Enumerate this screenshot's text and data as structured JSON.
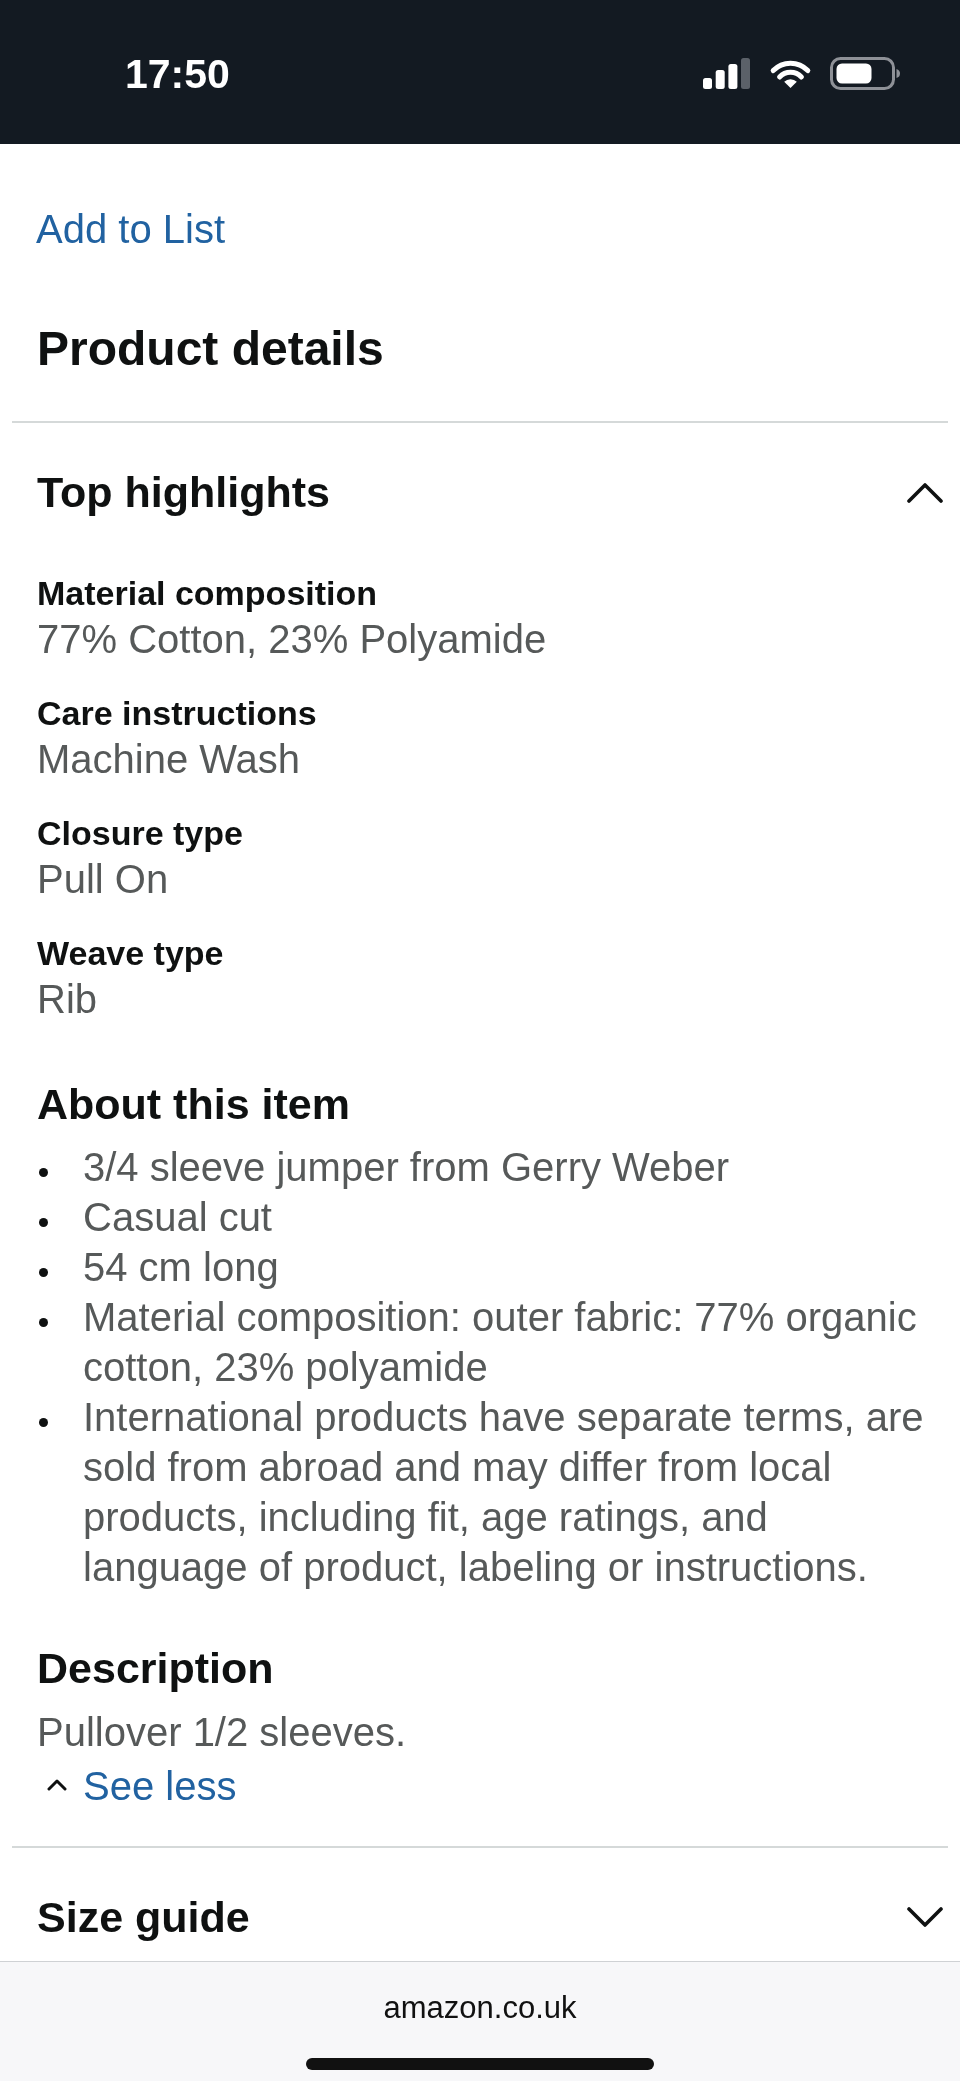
{
  "status_bar": {
    "time": "17:50"
  },
  "add_to_list_link": "Add to List",
  "product_details": {
    "title": "Product details",
    "accordions": [
      {
        "title": "Top highlights",
        "expanded": true,
        "attributes": [
          {
            "label": "Material composition",
            "value": "77% Cotton, 23% Polyamide"
          },
          {
            "label": "Care instructions",
            "value": "Machine Wash"
          },
          {
            "label": "Closure type",
            "value": "Pull On"
          },
          {
            "label": "Weave type",
            "value": "Rib"
          }
        ],
        "about": {
          "title": "About this item",
          "bullets": [
            "3/4 sleeve jumper from Gerry Weber",
            "Casual cut",
            "54 cm long",
            "Material composition: outer fabric: 77% organic cotton, 23% polyamide",
            "International products have separate terms, are sold from abroad and may differ from local products, including fit, age ratings, and language of product, labeling or instructions."
          ]
        },
        "description": {
          "title": "Description",
          "text": "Pullover 1/2 sleeves.",
          "toggle_link": "See less"
        }
      },
      {
        "title": "Size guide",
        "expanded": false
      }
    ]
  },
  "browser_bar": {
    "url": "amazon.co.uk"
  }
}
